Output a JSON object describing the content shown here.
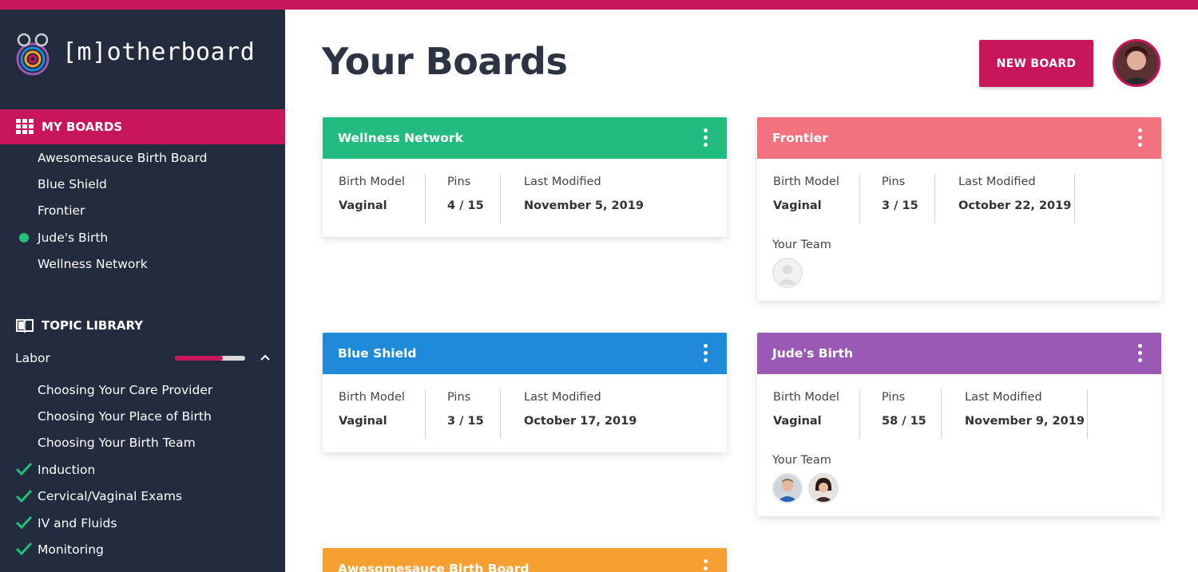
{
  "app": {
    "brand": "[m]otherboard"
  },
  "colors": {
    "accent": "#c8165a",
    "sidebar_bg": "#222c3e",
    "check": "#22c07b"
  },
  "sidebar": {
    "my_boards": {
      "label": "MY BOARDS",
      "icon": "grid-icon",
      "items": [
        {
          "label": "Awesomesauce Birth Board"
        },
        {
          "label": "Blue Shield"
        },
        {
          "label": "Frontier"
        },
        {
          "label": "Jude's Birth",
          "active_dot": true
        },
        {
          "label": "Wellness Network"
        }
      ]
    },
    "topic_library": {
      "label": "TOPIC LIBRARY",
      "icon": "book-icon",
      "category": {
        "label": "Labor",
        "progress": 0.68,
        "expanded": true
      },
      "items": [
        {
          "label": "Choosing Your Care Provider",
          "checked": false
        },
        {
          "label": "Choosing Your Place of Birth",
          "checked": false
        },
        {
          "label": "Choosing Your Birth Team",
          "checked": false
        },
        {
          "label": "Induction",
          "checked": true
        },
        {
          "label": "Cervical/Vaginal Exams",
          "checked": true
        },
        {
          "label": "IV and Fluids",
          "checked": true
        },
        {
          "label": "Monitoring",
          "checked": true
        }
      ]
    }
  },
  "main": {
    "title": "Your Boards",
    "new_board_label": "NEW BOARD",
    "stat_labels": {
      "birth_model": "Birth Model",
      "pins": "Pins",
      "last_modified": "Last Modified",
      "team": "Your Team"
    },
    "cards": [
      {
        "name": "Wellness Network",
        "color": "#22bc7e",
        "birth_model": "Vaginal",
        "pins": "4 / 15",
        "last_modified": "November 5, 2019",
        "team": []
      },
      {
        "name": "Frontier",
        "color": "#f2737f",
        "birth_model": "Vaginal",
        "pins": "3 / 15",
        "last_modified": "October 22, 2019",
        "team": [
          "placeholder"
        ]
      },
      {
        "name": "Blue Shield",
        "color": "#1e8ad8",
        "birth_model": "Vaginal",
        "pins": "3 / 15",
        "last_modified": "October 17, 2019",
        "team": []
      },
      {
        "name": "Jude's Birth",
        "color": "#9b59b6",
        "birth_model": "Vaginal",
        "pins": "58 / 15",
        "last_modified": "November 9, 2019",
        "team": [
          "man",
          "woman"
        ]
      },
      {
        "name": "Awesomesauce Birth Board",
        "color": "#f5a031",
        "birth_model": "",
        "pins": "",
        "last_modified": "",
        "team": []
      }
    ]
  }
}
